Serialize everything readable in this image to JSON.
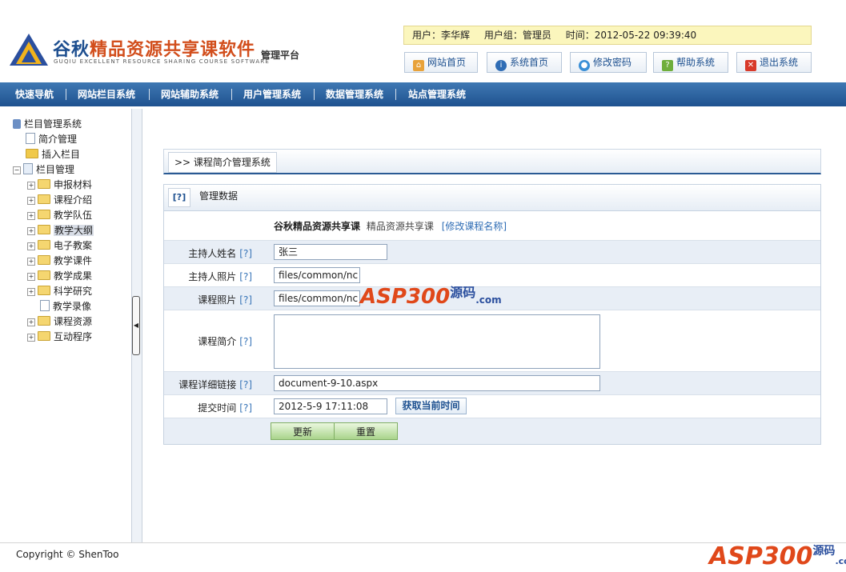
{
  "header": {
    "title_main": "谷秋",
    "title_rest": "精品资源共享课软件",
    "subtitle": "管理平台",
    "english": "GUQIU EXCELLENT RESOURCE SHARING COURSE SOFTWARE"
  },
  "userbar": {
    "user": "用户：李华辉",
    "group": "用户组：管理员",
    "time": "时间：2012-05-22 09:39:40"
  },
  "top_buttons": [
    {
      "label": "网站首页",
      "icon": "home-icon"
    },
    {
      "label": "系统首页",
      "icon": "info-icon"
    },
    {
      "label": "修改密码",
      "icon": "pin-icon"
    },
    {
      "label": "帮助系统",
      "icon": "help-icon"
    },
    {
      "label": "退出系统",
      "icon": "close-icon"
    }
  ],
  "nav": [
    "快速导航",
    "网站栏目系统",
    "网站辅助系统",
    "用户管理系统",
    "数据管理系统",
    "站点管理系统"
  ],
  "tree": {
    "root": "栏目管理系统",
    "intro": "简介管理",
    "insert": "插入栏目",
    "manage": "栏目管理",
    "children": [
      "申报材料",
      "课程介绍",
      "教学队伍",
      "教学大纲",
      "电子教案",
      "教学课件",
      "教学成果",
      "科学研究",
      "教学录像",
      "课程资源",
      "互动程序"
    ]
  },
  "breadcrumb": ">> 课程简介管理系统",
  "panel": {
    "help": "[?]",
    "title": "管理数据",
    "course_name": "谷秋精品资源共享课",
    "course_type": "精品资源共享课",
    "rename_link": "[修改课程名称]"
  },
  "form": {
    "help": "[?]",
    "host_name_label": "主持人姓名",
    "host_name_value": "张三",
    "host_photo_label": "主持人照片",
    "host_photo_value": "files/common/nc",
    "course_photo_label": "课程照片",
    "course_photo_value": "files/common/nc",
    "course_intro_label": "课程简介",
    "course_intro_value": "",
    "detail_link_label": "课程详细链接",
    "detail_link_value": "document-9-10.aspx",
    "submit_time_label": "提交时间",
    "submit_time_value": "2012-5-9 17:11:08",
    "get_time_button": "获取当前时间",
    "update_button": "更新",
    "reset_button": "重置"
  },
  "watermark": {
    "asp": "ASP300",
    "yuanma": "源码",
    "com": ".com"
  },
  "footer": {
    "copyright": "Copyright © ShenToo"
  }
}
